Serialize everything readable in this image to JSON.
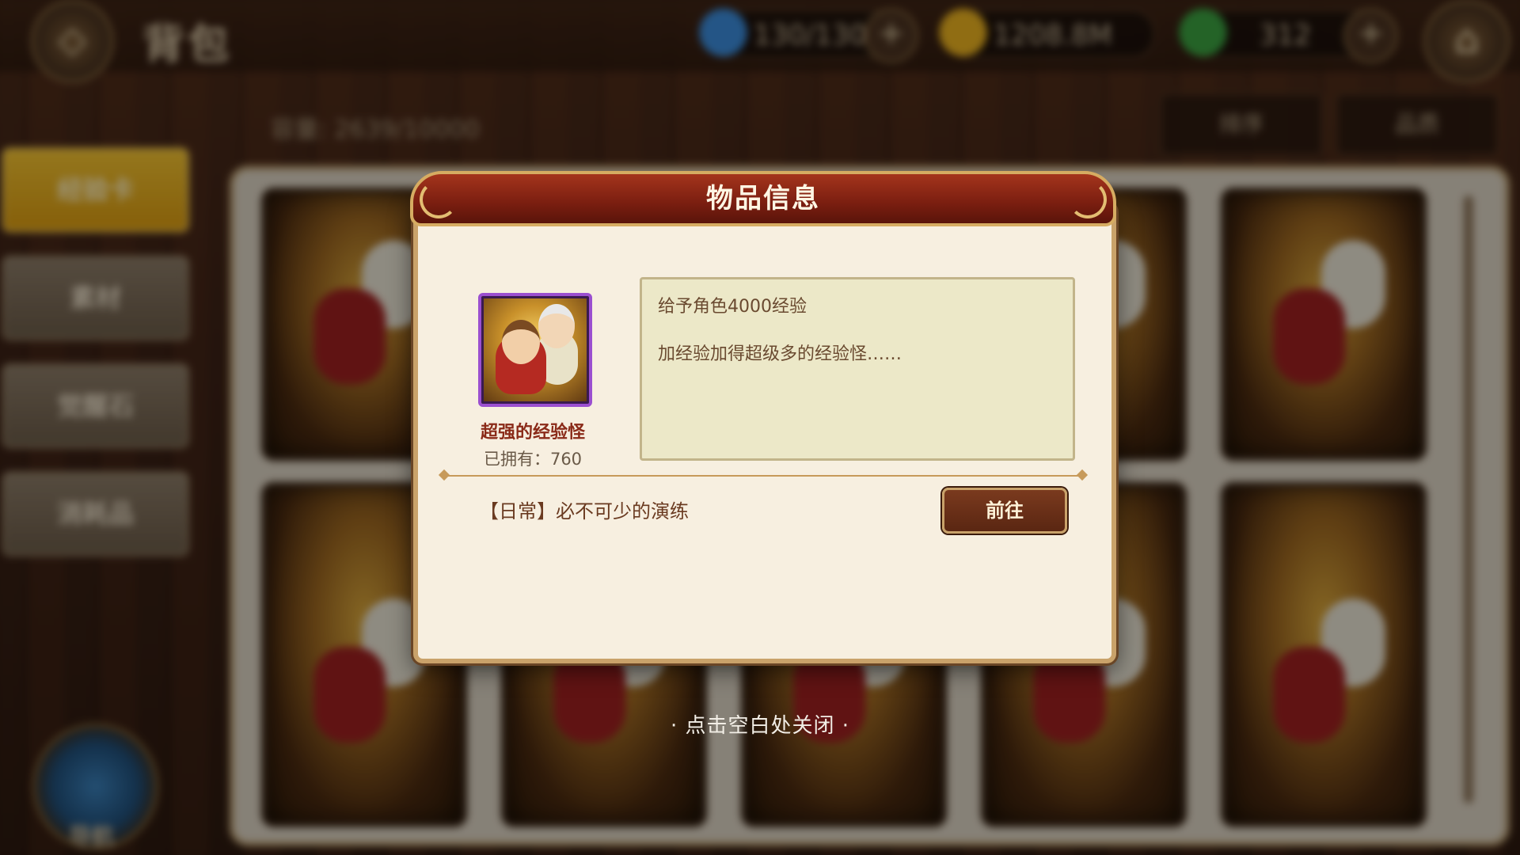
{
  "header": {
    "title": "背包",
    "resources": [
      {
        "name": "stamina",
        "value": "130/130",
        "color": "#3a8ad8"
      },
      {
        "name": "gold",
        "value": "1208.8M",
        "color": "#e8b020"
      },
      {
        "name": "leaf",
        "value": "312",
        "color": "#3aa040"
      }
    ]
  },
  "storage": {
    "capacity": "容量: 2639/10000"
  },
  "sort": {
    "filter_label": "排序",
    "order_label": "品质"
  },
  "sidebar": {
    "tabs": [
      {
        "label": "经验卡",
        "active": true
      },
      {
        "label": "素材",
        "active": false
      },
      {
        "label": "觉醒石",
        "active": false
      },
      {
        "label": "消耗品",
        "active": false
      }
    ],
    "compass_label": "导航"
  },
  "modal": {
    "title": "物品信息",
    "item": {
      "name": "超强的经验怪",
      "owned": "已拥有：760",
      "icon": "exp-monster-icon",
      "frame_color": "#9b4fd0"
    },
    "description": {
      "line1": "给予角色4000经验",
      "line2": "加经验加得超级多的经验怪……"
    },
    "source": {
      "text": "【日常】必不可少的演练",
      "goto_label": "前往"
    }
  },
  "close_hint": "· 点击空白处关闭 ·"
}
